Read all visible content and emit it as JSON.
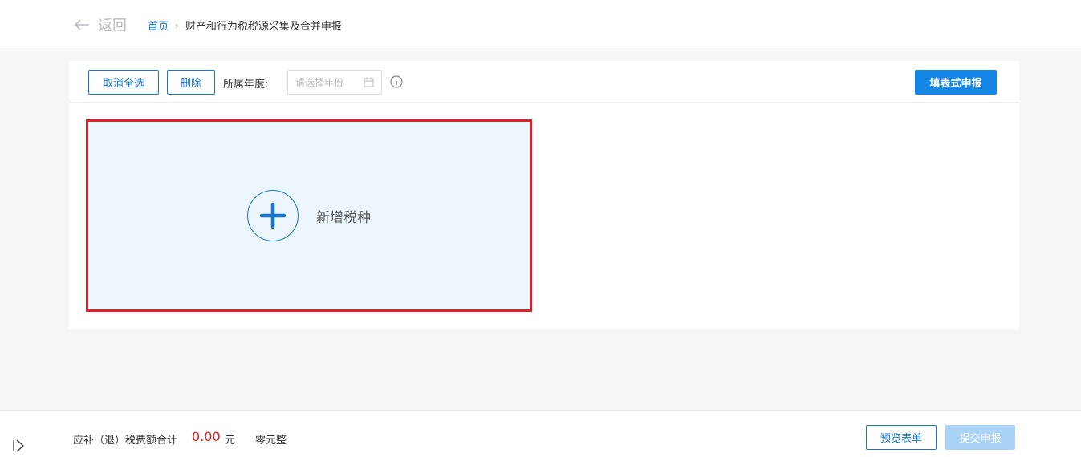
{
  "header": {
    "back_label": "返回",
    "breadcrumb": {
      "home": "首页",
      "separator": "›",
      "current": "财产和行为税税源采集及合并申报"
    }
  },
  "toolbar": {
    "cancel_select_label": "取消全选",
    "delete_label": "删除",
    "year_label": "所属年度:",
    "year_placeholder": "请选择年份",
    "fill_form_label": "填表式申报"
  },
  "add_card": {
    "label": "新增税种"
  },
  "footer": {
    "sum_label": "应补（退）税费额合计",
    "sum_value": "0.00",
    "sum_unit": "元",
    "sum_words": "零元整",
    "preview_label": "预览表单",
    "submit_label": "提交申报"
  },
  "colors": {
    "primary": "#1386e8",
    "link": "#1677d2",
    "highlight_border": "#d9232d",
    "amount": "#e02020"
  }
}
